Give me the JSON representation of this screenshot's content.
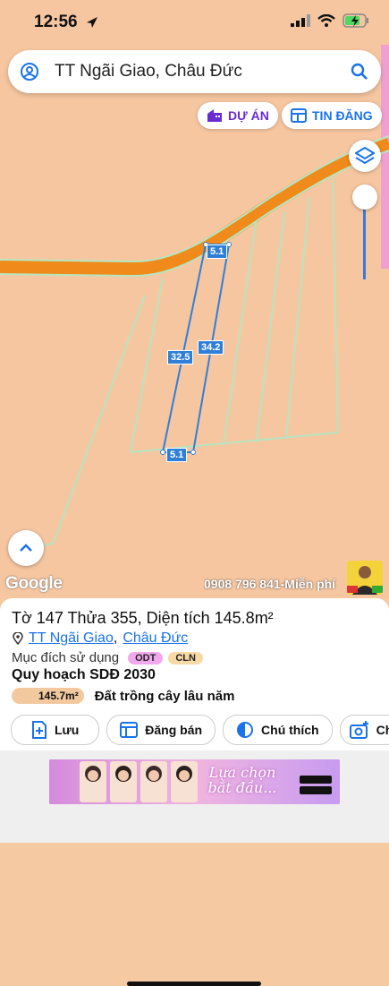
{
  "status_bar": {
    "time": "12:56"
  },
  "search": {
    "query": "TT Ngãi Giao, Châu Đức"
  },
  "top_chips": {
    "project": "DỰ ÁN",
    "listing": "TIN ĐĂNG"
  },
  "map": {
    "measurements": {
      "top": "5.1",
      "left_side": "32.5",
      "right_side": "34.2",
      "bottom": "5.1"
    },
    "brand": "Google",
    "ad_banner": "0908 796 841-Miễn phí"
  },
  "parcel": {
    "title": "Tờ 147 Thửa 355, Diện tích 145.8m²",
    "ward": "TT Ngãi Giao",
    "separator": ",",
    "district": "Châu Đức",
    "purpose_label": "Mục đích sử dụng",
    "purpose_tags": [
      "ODT",
      "CLN"
    ],
    "plan_title": "Quy hoạch SDĐ 2030",
    "plan_area": "145.7m²",
    "plan_use": "Đất trồng cây lâu năm"
  },
  "actions": {
    "save": "Lưu",
    "post_sale": "Đăng bán",
    "legend": "Chú thích",
    "more": "Ch"
  },
  "ad": {
    "text": "Lựa chọn bắt đầu..."
  },
  "colors": {
    "road": "#f08a1a",
    "parcel_border": "#2f7fd8",
    "plot_lines": "#b6e4bf"
  }
}
